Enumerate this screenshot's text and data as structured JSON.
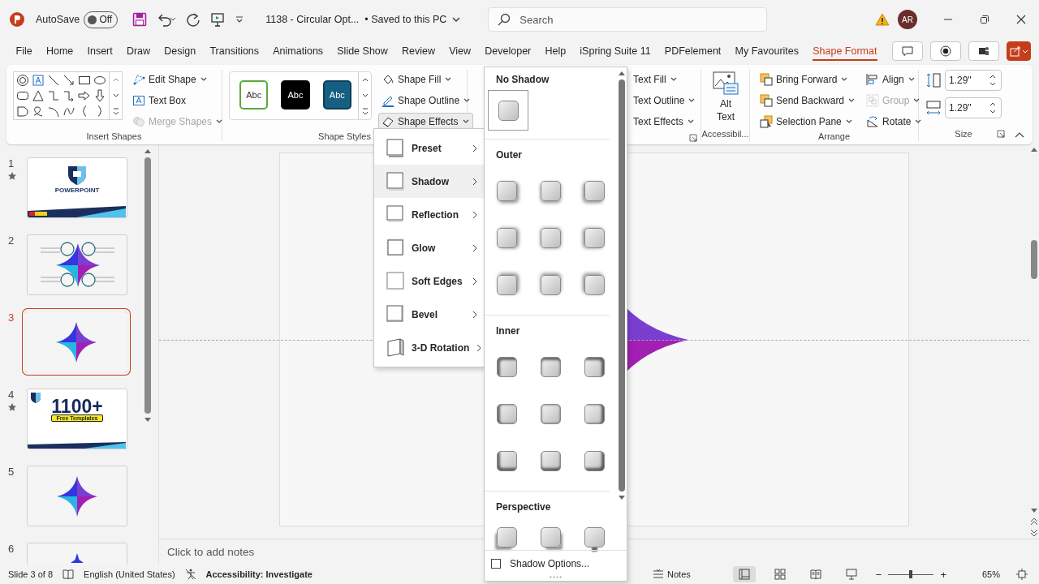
{
  "title_bar": {
    "autosave_label": "AutoSave",
    "autosave": {
      "on": false,
      "label": "Off"
    },
    "document_title": "1138 - Circular Opt...",
    "save_status": "• Saved to this PC",
    "search": {
      "placeholder": "Search"
    },
    "avatar": "AR"
  },
  "tabs": [
    {
      "label": "File",
      "selected": false
    },
    {
      "label": "Home",
      "selected": false
    },
    {
      "label": "Insert",
      "selected": false
    },
    {
      "label": "Draw",
      "selected": false
    },
    {
      "label": "Design",
      "selected": false
    },
    {
      "label": "Transitions",
      "selected": false
    },
    {
      "label": "Animations",
      "selected": false
    },
    {
      "label": "Slide Show",
      "selected": false
    },
    {
      "label": "Review",
      "selected": false
    },
    {
      "label": "View",
      "selected": false
    },
    {
      "label": "Developer",
      "selected": false
    },
    {
      "label": "Help",
      "selected": false
    },
    {
      "label": "iSpring Suite 11",
      "selected": false
    },
    {
      "label": "PDFelement",
      "selected": false
    },
    {
      "label": "My Favourites",
      "selected": false
    },
    {
      "label": "Shape Format",
      "selected": true
    }
  ],
  "ribbon": {
    "insert_shapes": {
      "label": "Insert Shapes",
      "buttons": [
        {
          "label": "Edit Shape",
          "disabled": false
        },
        {
          "label": "Text Box",
          "disabled": false
        },
        {
          "label": "Merge Shapes",
          "disabled": true
        }
      ]
    },
    "shape_styles": {
      "label": "Shape Styles",
      "styles": [
        {
          "label": "Abc",
          "kind": "outline"
        },
        {
          "label": "Abc",
          "kind": "black"
        },
        {
          "label": "Abc",
          "kind": "teal"
        }
      ],
      "buttons": [
        {
          "label": "Shape Fill",
          "expanded": false
        },
        {
          "label": "Shape Outline",
          "expanded": false
        },
        {
          "label": "Shape Effects",
          "expanded": true
        }
      ]
    },
    "wordart": {
      "buttons": [
        {
          "label": "Text Fill"
        },
        {
          "label": "Text Outline"
        },
        {
          "label": "Text Effects"
        }
      ]
    },
    "accessibility": {
      "label": "Accessibil...",
      "button": "Alt Text"
    },
    "arrange": {
      "label": "Arrange",
      "buttons": [
        {
          "label": "Bring Forward",
          "kind": "forward",
          "disabled": false
        },
        {
          "label": "Align",
          "kind": "align",
          "disabled": false
        },
        {
          "label": "Send Backward",
          "kind": "backward",
          "disabled": false
        },
        {
          "label": "Group",
          "kind": "group",
          "disabled": true
        },
        {
          "label": "Selection Pane",
          "kind": "pane",
          "disabled": false
        },
        {
          "label": "Rotate",
          "kind": "rotate",
          "disabled": false
        }
      ]
    },
    "size": {
      "label": "Size",
      "height": "1.29\"",
      "width": "1.29\""
    }
  },
  "slides": [
    {
      "number": "1",
      "starred": true,
      "selected": false,
      "kind": "title",
      "texts": [
        "POWERPOINT"
      ]
    },
    {
      "number": "2",
      "starred": false,
      "selected": false,
      "kind": "diagram"
    },
    {
      "number": "3",
      "starred": false,
      "selected": true,
      "kind": "shape"
    },
    {
      "number": "4",
      "starred": true,
      "selected": false,
      "kind": "promo",
      "texts": [
        "1100+",
        "Free Templates"
      ]
    },
    {
      "number": "5",
      "starred": false,
      "selected": false,
      "kind": "shape"
    },
    {
      "number": "6",
      "starred": false,
      "selected": false,
      "kind": "partial"
    }
  ],
  "notes": {
    "placeholder": "Click to add notes"
  },
  "effects_menu": {
    "items": [
      {
        "label": "Preset",
        "selected": false
      },
      {
        "label": "Shadow",
        "selected": true
      },
      {
        "label": "Reflection",
        "selected": false
      },
      {
        "label": "Glow",
        "selected": false
      },
      {
        "label": "Soft Edges",
        "selected": false
      },
      {
        "label": "Bevel",
        "selected": false
      },
      {
        "label": "3-D Rotation",
        "selected": false
      }
    ]
  },
  "shadow_gallery": {
    "sections": [
      {
        "title": "No Shadow",
        "kind": "none",
        "items": [
          {
            "selected": true
          }
        ]
      },
      {
        "title": "Outer",
        "kind": "outer",
        "items": [
          {
            "selected": false
          },
          {
            "selected": false
          },
          {
            "selected": false
          },
          {
            "selected": false
          },
          {
            "selected": false
          },
          {
            "selected": false
          },
          {
            "selected": false
          },
          {
            "selected": false
          },
          {
            "selected": false
          }
        ]
      },
      {
        "title": "Inner",
        "kind": "inner",
        "items": [
          {
            "selected": false
          },
          {
            "selected": false
          },
          {
            "selected": false
          },
          {
            "selected": false
          },
          {
            "selected": false
          },
          {
            "selected": false
          },
          {
            "selected": false
          },
          {
            "selected": false
          },
          {
            "selected": false
          }
        ]
      },
      {
        "title": "Perspective",
        "kind": "perspective",
        "items": [
          {
            "selected": false
          },
          {
            "selected": false
          },
          {
            "selected": false
          }
        ]
      }
    ],
    "options": {
      "label": "Shadow Options...",
      "checked": false
    }
  },
  "status_bar": {
    "slide": "Slide 3 of 8",
    "language": "English (United States)",
    "accessibility": "Accessibility: Investigate",
    "notes": "Notes",
    "views": [
      {
        "kind": "normal",
        "selected": true
      },
      {
        "kind": "sorter",
        "selected": false
      },
      {
        "kind": "reading",
        "selected": false
      },
      {
        "kind": "show",
        "selected": false
      }
    ],
    "zoom": {
      "level": 0.49,
      "minus": "−",
      "plus": "+",
      "reading": "65%"
    }
  }
}
